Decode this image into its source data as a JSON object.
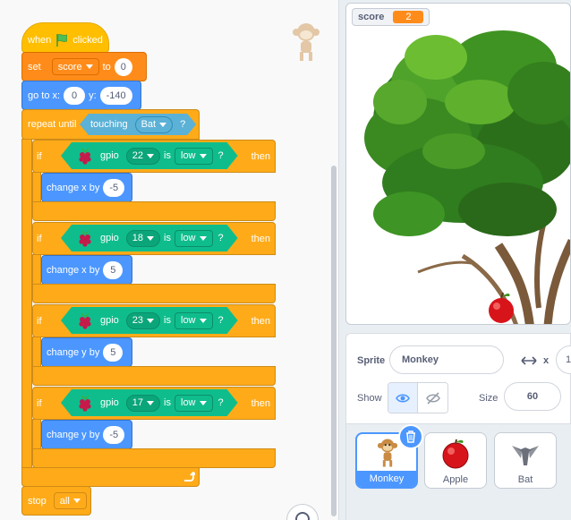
{
  "script": {
    "hat": {
      "prefix": "when",
      "suffix": "clicked",
      "flag_icon": "green-flag-icon"
    },
    "set_var": {
      "label": "set",
      "variable": "score",
      "to_label": "to",
      "value": "0"
    },
    "goto": {
      "label": "go to x:",
      "x": "0",
      "y_label": "y:",
      "y": "-140"
    },
    "repeat": {
      "label": "repeat until",
      "touching_label": "touching",
      "target": "Bat",
      "q": "?"
    },
    "ifs": [
      {
        "if_label": "if",
        "gpio_label": "gpio",
        "pin": "22",
        "is_label": "is",
        "level": "low",
        "q": "?",
        "then_label": "then",
        "action_label": "change x by",
        "action_value": "-5"
      },
      {
        "if_label": "if",
        "gpio_label": "gpio",
        "pin": "18",
        "is_label": "is",
        "level": "low",
        "q": "?",
        "then_label": "then",
        "action_label": "change x by",
        "action_value": "5"
      },
      {
        "if_label": "if",
        "gpio_label": "gpio",
        "pin": "23",
        "is_label": "is",
        "level": "low",
        "q": "?",
        "then_label": "then",
        "action_label": "change y by",
        "action_value": "5"
      },
      {
        "if_label": "if",
        "gpio_label": "gpio",
        "pin": "17",
        "is_label": "is",
        "level": "low",
        "q": "?",
        "then_label": "then",
        "action_label": "change y by",
        "action_value": "-5"
      }
    ],
    "stop": {
      "label": "stop",
      "option": "all"
    }
  },
  "stage": {
    "monitor": {
      "name": "score",
      "value": "2"
    }
  },
  "sprite_info": {
    "sprite_label": "Sprite",
    "sprite_name": "Monkey",
    "x_label": "x",
    "x_value": "1",
    "show_label": "Show",
    "size_label": "Size",
    "size_value": "60"
  },
  "sprites": [
    {
      "name": "Monkey",
      "selected": true
    },
    {
      "name": "Apple",
      "selected": false
    },
    {
      "name": "Bat",
      "selected": false
    }
  ],
  "colors": {
    "events": "#ffbf00",
    "variables": "#ff8c1a",
    "motion": "#4c97ff",
    "control": "#ffab19",
    "sensing": "#5cb1d6",
    "raspberry_pi": "#0fbd8c"
  }
}
